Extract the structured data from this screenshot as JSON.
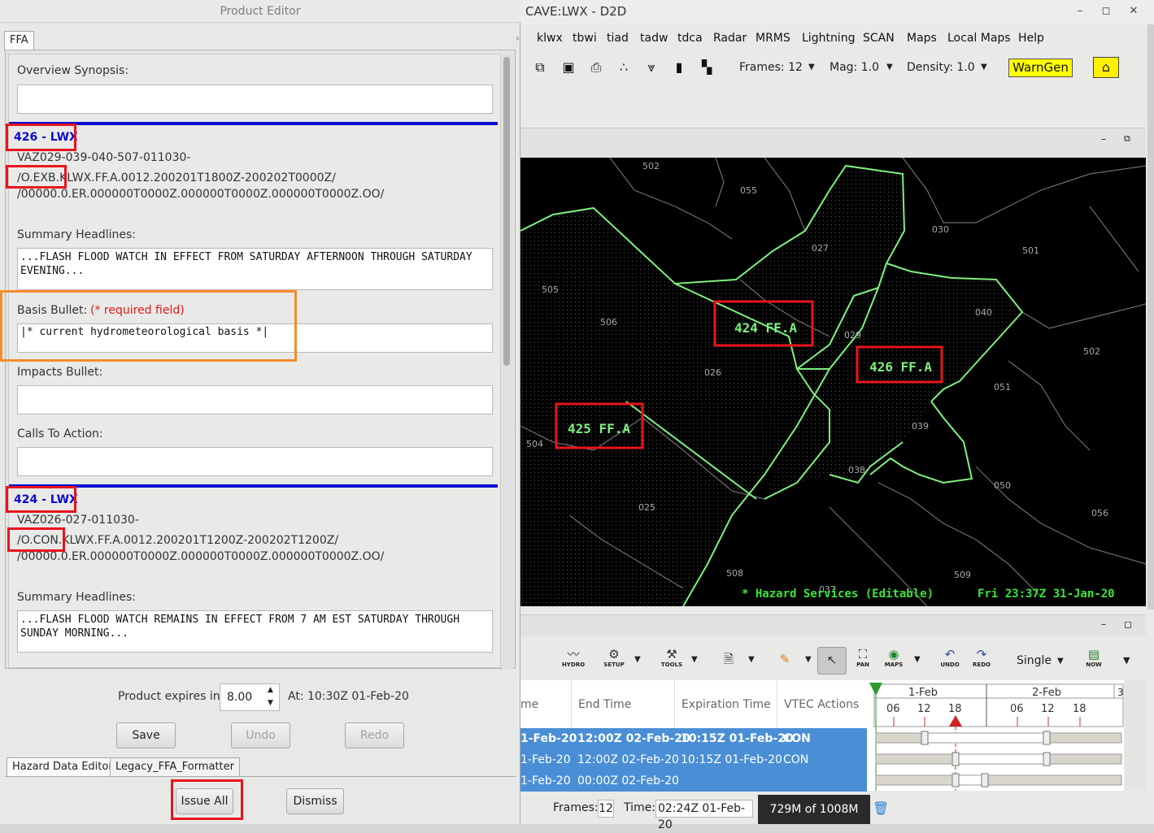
{
  "product_editor": {
    "title": "Product Editor",
    "tab": "FFA",
    "overview_label": "Overview Synopsis:",
    "segments": [
      {
        "id": "426 - LWX",
        "ugc": "VAZ029-039-040-507-011030-",
        "vtec1_prefix": "/O.EXB.K",
        "vtec1_rest": "LWX.FF.A.0012.200201T1800Z-200202T0000Z/",
        "vtec2": "/00000.0.ER.000000T0000Z.000000T0000Z.000000T0000Z.OO/",
        "summary_label": "Summary Headlines:",
        "summary_text": "...FLASH FLOOD WATCH IN EFFECT FROM SATURDAY AFTERNOON THROUGH SATURDAY\nEVENING...",
        "basis_label": "Basis Bullet:",
        "required": "(* required field)",
        "basis_text": "|* current hydrometeorological basis *|",
        "impacts_label": "Impacts Bullet:",
        "calls_label": "Calls To Action:"
      },
      {
        "id": "424 - LWX",
        "ugc": "VAZ026-027-011030-",
        "vtec1_prefix": "/O.CON.",
        "vtec1_rest": "KLWX.FF.A.0012.200201T1200Z-200202T1200Z/",
        "vtec2": "/00000.0.ER.000000T0000Z.000000T0000Z.000000T0000Z.OO/",
        "summary_label": "Summary Headlines:",
        "summary_text": "...FLASH FLOOD WATCH REMAINS IN EFFECT FROM 7 AM EST SATURDAY THROUGH\nSUNDAY MORNING..."
      }
    ],
    "expires_label": "Product expires in:",
    "expires_value": "8.00",
    "at_text": "At: 10:30Z 01-Feb-20",
    "save": "Save",
    "undo": "Undo",
    "redo": "Redo",
    "bottom_tabs": [
      "Hazard Data Editor",
      "Legacy_FFA_Formatter"
    ],
    "issue_all": "Issue All",
    "dismiss": "Dismiss"
  },
  "d2d": {
    "title": "CAVE:LWX - D2D",
    "menu": [
      "klwx",
      "tbwi",
      "tiad",
      "tadw",
      "tdca",
      "Radar",
      "MRMS",
      "Lightning",
      "SCAN",
      "Maps",
      "Local Maps",
      "Help"
    ],
    "frames": "Frames: 12",
    "mag": "Mag: 1.0",
    "density": "Density: 1.0",
    "warngen": "WarnGen",
    "map_status": "* Hazard Services (Editable)",
    "map_time": "Fri 23:37Z 31-Jan-20",
    "hazard_labels": [
      "424 FF.A",
      "426 FF.A",
      "425 FF.A"
    ],
    "zones": [
      "502",
      "055",
      "030",
      "027",
      "501",
      "505",
      "506",
      "040",
      "029",
      "502",
      "026",
      "051",
      "039",
      "504",
      "038",
      "050",
      "025",
      "056",
      "509",
      "508",
      "037"
    ]
  },
  "hazard_services": {
    "tools": [
      {
        "icon": "hydro-icon",
        "label": "HYDRO"
      },
      {
        "icon": "setup-icon",
        "label": "SETUP"
      },
      {
        "icon": "tools-icon",
        "label": "TOOLS"
      },
      {
        "icon": "pan-icon",
        "label": "PAN"
      },
      {
        "icon": "maps-icon",
        "label": "MAPS"
      },
      {
        "icon": "undo-icon",
        "label": "UNDO"
      },
      {
        "icon": "redo-icon",
        "label": "REDO"
      },
      {
        "icon": "now-icon",
        "label": "NOW"
      }
    ],
    "mode": "Single",
    "columns": [
      "me",
      "End Time",
      "Expiration Time",
      "VTEC Actions"
    ],
    "rows": [
      {
        "start": "1-Feb-20",
        "end": "12:00Z 02-Feb-20",
        "exp": "10:15Z 01-Feb-20",
        "vtec": "CON"
      },
      {
        "start": "1-Feb-20",
        "end": "12:00Z 02-Feb-20",
        "exp": "10:15Z 01-Feb-20",
        "vtec": "CON"
      },
      {
        "start": "1-Feb-20",
        "end": "00:00Z 02-Feb-20",
        "exp": "",
        "vtec": ""
      }
    ],
    "timeline_days": [
      "1-Feb",
      "2-Feb",
      "3"
    ],
    "timeline_hours": [
      "06",
      "12",
      "18",
      "06",
      "12",
      "18"
    ]
  },
  "status": {
    "frames_label": "Frames:",
    "frames_value": "12",
    "time_label": "Time:",
    "time_value": "02:24Z 01-Feb-20",
    "memory": "729M of 1008M"
  }
}
